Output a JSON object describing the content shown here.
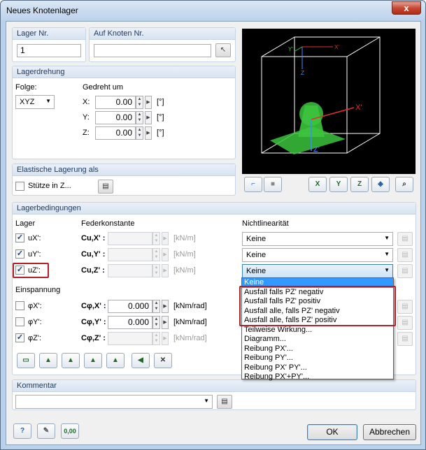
{
  "window": {
    "title": "Neues Knotenlager",
    "close_label": "x"
  },
  "lager_nr": {
    "label": "Lager Nr.",
    "value": "1"
  },
  "auf_knoten": {
    "label": "Auf Knoten Nr.",
    "value": ""
  },
  "lagerdrehung": {
    "header": "Lagerdrehung",
    "folge_label": "Folge:",
    "folge_value": "XYZ",
    "gedreht_label": "Gedreht um",
    "rows": [
      {
        "axis": "X:",
        "value": "0.00",
        "unit": "[°]"
      },
      {
        "axis": "Y:",
        "value": "0.00",
        "unit": "[°]"
      },
      {
        "axis": "Z:",
        "value": "0.00",
        "unit": "[°]"
      }
    ]
  },
  "elastisch": {
    "header": "Elastische Lagerung als",
    "stuetze_label": "Stütze in Z..."
  },
  "lagerbedingungen": {
    "header": "Lagerbedingungen",
    "lager_label": "Lager",
    "feder_label": "Federkonstante",
    "nichtlin_label": "Nichtlinearität",
    "lager_rows": [
      {
        "checked": true,
        "name": "uX':",
        "c_label": "Cu,X' :",
        "value": "",
        "unit": "[kN/m]",
        "nl": "Keine"
      },
      {
        "checked": true,
        "name": "uY':",
        "c_label": "Cu,Y' :",
        "value": "",
        "unit": "[kN/m]",
        "nl": "Keine"
      },
      {
        "checked": true,
        "name": "uZ':",
        "c_label": "Cu,Z' :",
        "value": "",
        "unit": "[kN/m]",
        "nl": "Keine"
      }
    ],
    "einspannung_label": "Einspannung",
    "einsp_rows": [
      {
        "checked": false,
        "name": "φX':",
        "c_label": "Cφ,X' :",
        "value": "0.000",
        "unit": "[kNm/rad]"
      },
      {
        "checked": false,
        "name": "φY':",
        "c_label": "Cφ,Y' :",
        "value": "0.000",
        "unit": "[kNm/rad]"
      },
      {
        "checked": true,
        "name": "φZ':",
        "c_label": "Cφ,Z' :",
        "value": "",
        "unit": "[kNm/rad]"
      }
    ],
    "dropdown_options": [
      "Keine",
      "Ausfall falls PZ' negativ",
      "Ausfall falls PZ' positiv",
      "Ausfall alle, falls PZ' negativ",
      "Ausfall alle, falls PZ' positiv",
      "Teilweise Wirkung...",
      "Diagramm...",
      "Reibung PX'...",
      "Reibung PY'...",
      "Reibung PX' PY'...",
      "Reibung PX'+PY'..."
    ],
    "selected_option": "Keine"
  },
  "kommentar": {
    "header": "Kommentar",
    "value": ""
  },
  "buttons": {
    "ok": "OK",
    "cancel": "Abbrechen",
    "calc_label": "0,00"
  },
  "view3d": {
    "axis_x": "X'",
    "axis_z": "Z'",
    "axis_x_top": "X'",
    "axis_z_top": "Z",
    "axis_y_top": "Y'"
  },
  "view_buttons": {
    "vx": "X",
    "vy": "Y",
    "vz": "Z"
  },
  "colors": {
    "accent": "#3399ff",
    "red_highlight": "#b0202a",
    "support_green": "#3cc43c"
  }
}
